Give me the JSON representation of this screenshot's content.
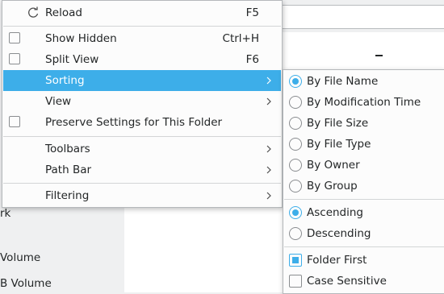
{
  "sidebar": {
    "items": [
      {
        "label": "rk"
      },
      {
        "label": "Volume"
      },
      {
        "label": "B Volume"
      }
    ]
  },
  "main_menu": {
    "items": [
      {
        "label": "Reload",
        "shortcut": "F5",
        "icon": "reload-icon"
      },
      {
        "label": "Show Hidden",
        "shortcut": "Ctrl+H",
        "checked": false
      },
      {
        "label": "Split View",
        "shortcut": "F6",
        "checked": false
      },
      {
        "label": "Sorting",
        "submenu": true,
        "active": true
      },
      {
        "label": "View",
        "submenu": true
      },
      {
        "label": "Preserve Settings for This Folder",
        "checked": false
      },
      {
        "label": "Toolbars",
        "submenu": true
      },
      {
        "label": "Path Bar",
        "submenu": true
      },
      {
        "label": "Filtering",
        "submenu": true
      }
    ]
  },
  "sorting_menu": {
    "sort_by": [
      {
        "label": "By File Name",
        "checked": true
      },
      {
        "label": "By Modification Time",
        "checked": false
      },
      {
        "label": "By File Size",
        "checked": false
      },
      {
        "label": "By File Type",
        "checked": false
      },
      {
        "label": "By Owner",
        "checked": false
      },
      {
        "label": "By Group",
        "checked": false
      }
    ],
    "order": [
      {
        "label": "Ascending",
        "checked": true
      },
      {
        "label": "Descending",
        "checked": false
      }
    ],
    "options": [
      {
        "label": "Folder First",
        "checked": true
      },
      {
        "label": "Case Sensitive",
        "checked": false
      }
    ]
  },
  "colors": {
    "highlight": "#3daee9",
    "menu_bg": "#fcfcfc",
    "window_bg": "#eff0f1"
  }
}
